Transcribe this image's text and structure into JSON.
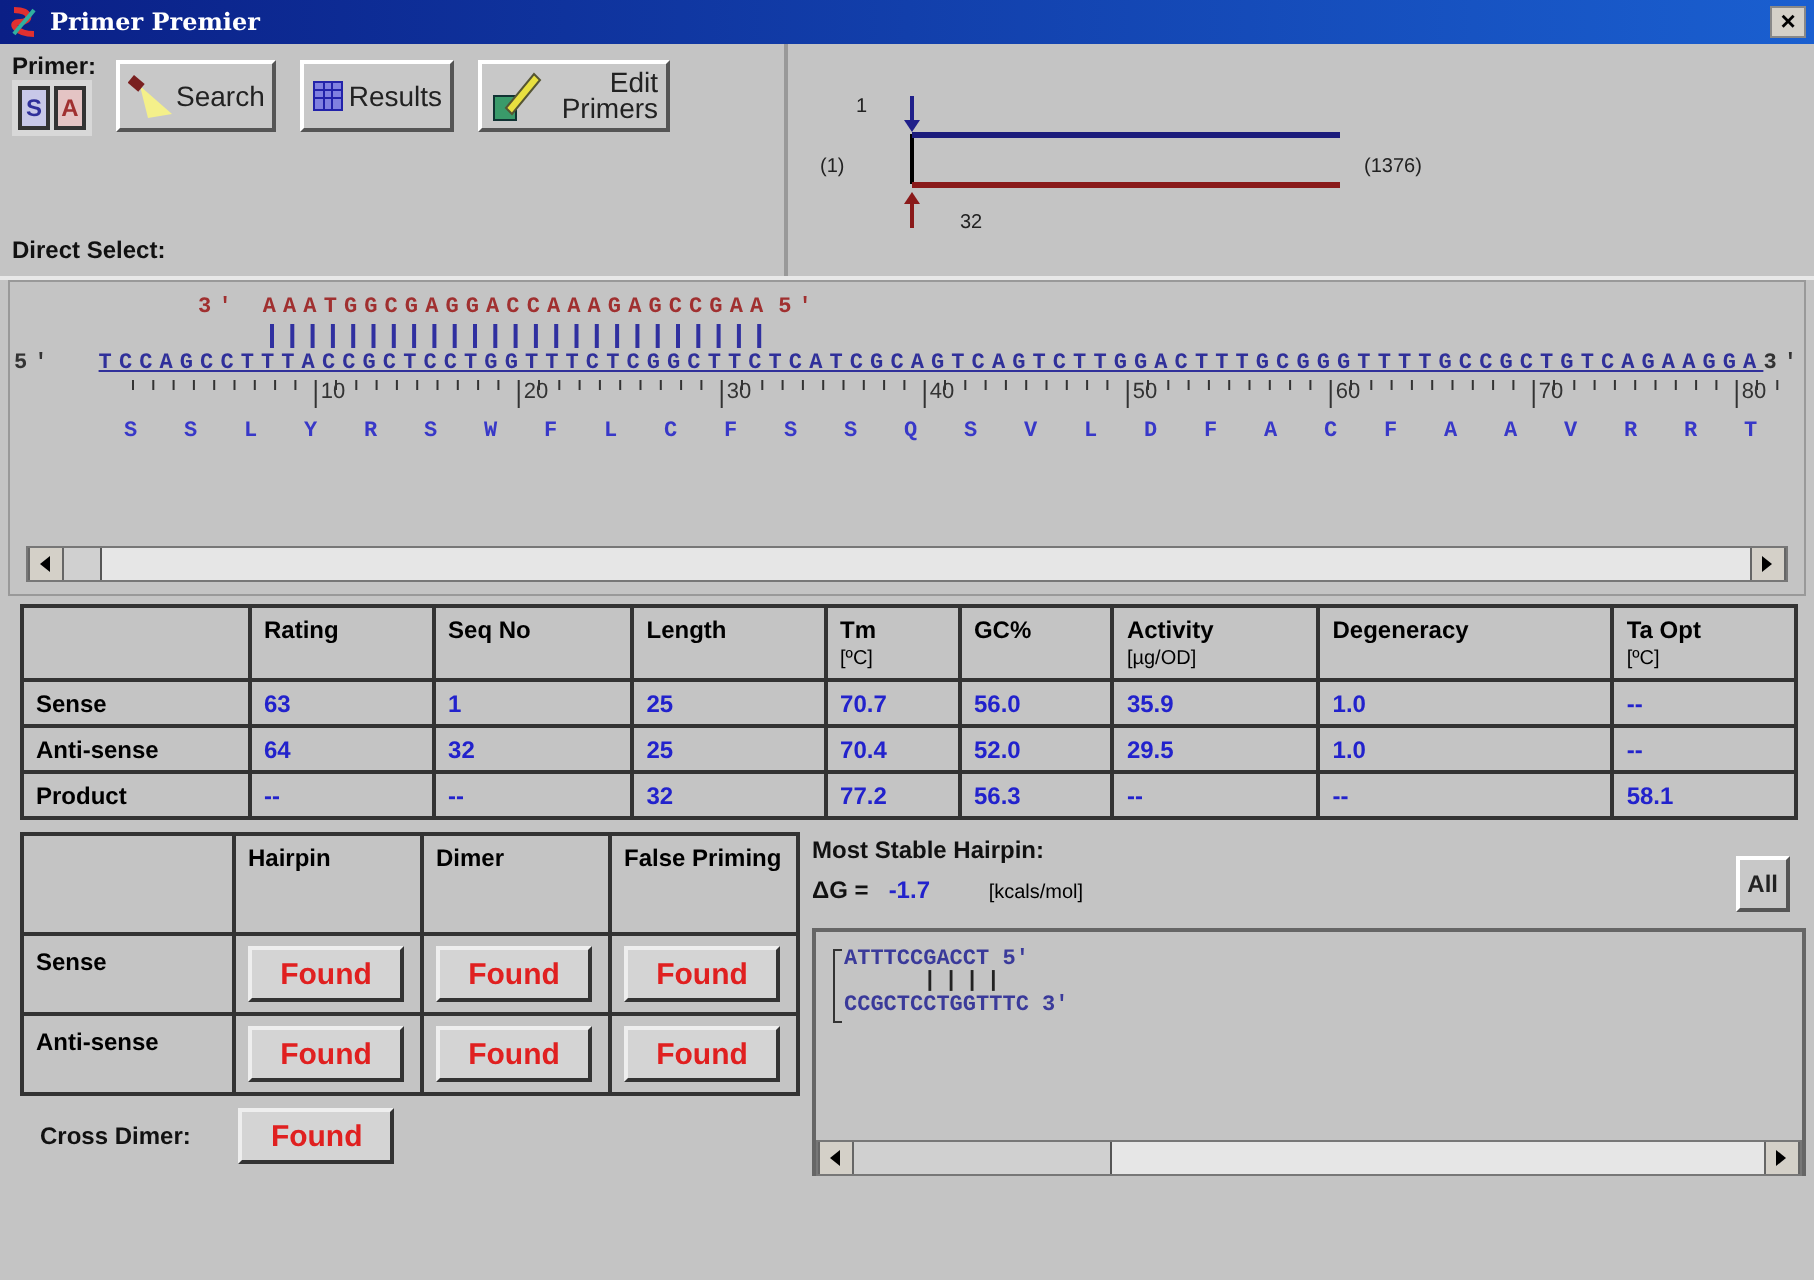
{
  "window": {
    "title": "Primer Premier",
    "close": "×"
  },
  "toolbar": {
    "primer_label": "Primer:",
    "strand_buttons": [
      {
        "label": "S",
        "kind": "sense"
      },
      {
        "label": "A",
        "kind": "antisense"
      }
    ],
    "buttons": [
      {
        "label": "Search",
        "kind": "search"
      },
      {
        "label": "Results",
        "kind": "results"
      },
      {
        "label": "Edit Primers",
        "kind": "edit"
      }
    ],
    "direct_select": "Direct Select:"
  },
  "map": {
    "start": "1",
    "left_label": "(1)",
    "right_label": "(1376)",
    "end": "32"
  },
  "sequence": {
    "primer_prime_left": "3'",
    "primer": "AAATGGCGAGGACCAAAGAGCCGAA",
    "primer_prime_right": "5'",
    "prime_left": "5'",
    "template": "TCCAGCCTTTACCGCTCCTGGTTTCTCGGCTTCTCATCGCAGTCAGTCTTGGACTTTGCGGGTTTTGCCGCTGTCAGAAGGA",
    "prime_right": "3'",
    "ruler": [
      "10",
      "20",
      "30",
      "40",
      "50",
      "60",
      "70",
      "80"
    ],
    "amino_acids": [
      "S",
      "S",
      "L",
      "Y",
      "R",
      "S",
      "W",
      "F",
      "L",
      "C",
      "F",
      "S",
      "S",
      "Q",
      "S",
      "V",
      "L",
      "D",
      "F",
      "A",
      "C",
      "F",
      "A",
      "A",
      "V",
      "R",
      "R",
      "T"
    ]
  },
  "results_table": {
    "columns": [
      {
        "label": "Rating"
      },
      {
        "label": "Seq No"
      },
      {
        "label": "Length"
      },
      {
        "label": "Tm",
        "unit": "[ºC]"
      },
      {
        "label": "GC%"
      },
      {
        "label": "Activity",
        "unit": "[µg/OD]"
      },
      {
        "label": "Degeneracy"
      },
      {
        "label": "Ta Opt",
        "unit": "[ºC]"
      }
    ],
    "rows": [
      {
        "name": "Sense",
        "values": [
          "63",
          "1",
          "25",
          "70.7",
          "56.0",
          "35.9",
          "1.0",
          "--"
        ]
      },
      {
        "name": "Anti-sense",
        "values": [
          "64",
          "32",
          "25",
          "70.4",
          "52.0",
          "29.5",
          "1.0",
          "--"
        ]
      },
      {
        "name": "Product",
        "values": [
          "--",
          "--",
          "32",
          "77.2",
          "56.3",
          "--",
          "--",
          "58.1"
        ]
      }
    ]
  },
  "checks_table": {
    "columns": [
      "Hairpin",
      "Dimer",
      "False Priming"
    ],
    "rows": [
      {
        "name": "Sense",
        "results": [
          "Found",
          "Found",
          "Found"
        ]
      },
      {
        "name": "Anti-sense",
        "results": [
          "Found",
          "Found",
          "Found"
        ]
      }
    ],
    "cross_dimer_label": "Cross Dimer:",
    "cross_dimer": "Found"
  },
  "hairpin": {
    "title": "Most Stable Hairpin:",
    "dg_label": "ΔG =",
    "dg_value": "-1.7",
    "unit": "[kcals/mol]",
    "all_button": "All",
    "top": "ATTTCCGACCT 5'",
    "pairs": "||||",
    "bottom": "CCGCTCCTGGTTTC 3'"
  }
}
